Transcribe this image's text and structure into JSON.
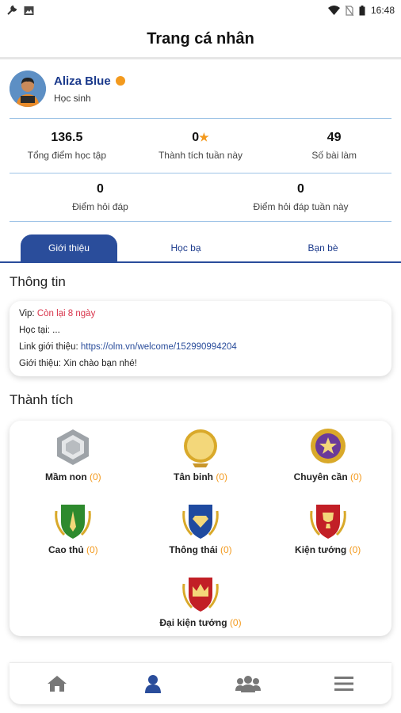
{
  "status_bar": {
    "time": "16:48"
  },
  "header": {
    "title": "Trang cá nhân"
  },
  "profile": {
    "name": "Aliza Blue",
    "role": "Học sinh"
  },
  "stats_row1": [
    {
      "value": "136.5",
      "label": "Tổng điểm học tập"
    },
    {
      "value": "0",
      "label": "Thành tích tuần này",
      "icon": "star-icon"
    },
    {
      "value": "49",
      "label": "Số bài làm"
    }
  ],
  "stats_row2": [
    {
      "value": "0",
      "label": "Điểm hỏi đáp"
    },
    {
      "value": "0",
      "label": "Điểm hỏi đáp tuần này"
    }
  ],
  "tabs": [
    {
      "label": "Giới thiệu",
      "active": true
    },
    {
      "label": "Học bạ"
    },
    {
      "label": "Bạn bè"
    }
  ],
  "info": {
    "title": "Thông tin",
    "vip_label": "Vip: ",
    "vip_value": "Còn lại 8 ngày",
    "study_label": "Học tại: ...",
    "link_label": "Link giới thiệu: ",
    "link_value": "https://olm.vn/welcome/152990994204",
    "intro_label": "Giới thiệu: Xin chào bạn nhé!"
  },
  "achievements": {
    "title": "Thành tích",
    "items": [
      {
        "name": "Mầm non",
        "count": "(0)"
      },
      {
        "name": "Tân binh",
        "count": "(0)"
      },
      {
        "name": "Chuyên cần",
        "count": "(0)"
      },
      {
        "name": "Cao thủ",
        "count": "(0)"
      },
      {
        "name": "Thông thái",
        "count": "(0)"
      },
      {
        "name": "Kiện tướng",
        "count": "(0)"
      },
      {
        "name": "Đại kiện tướng",
        "count": "(0)"
      }
    ]
  },
  "bottom_nav": [
    "home-icon",
    "profile-icon",
    "group-icon",
    "menu-icon"
  ],
  "colors": {
    "accent": "#2a4d9b",
    "orange": "#f39a1e",
    "vip_red": "#d8334a"
  }
}
